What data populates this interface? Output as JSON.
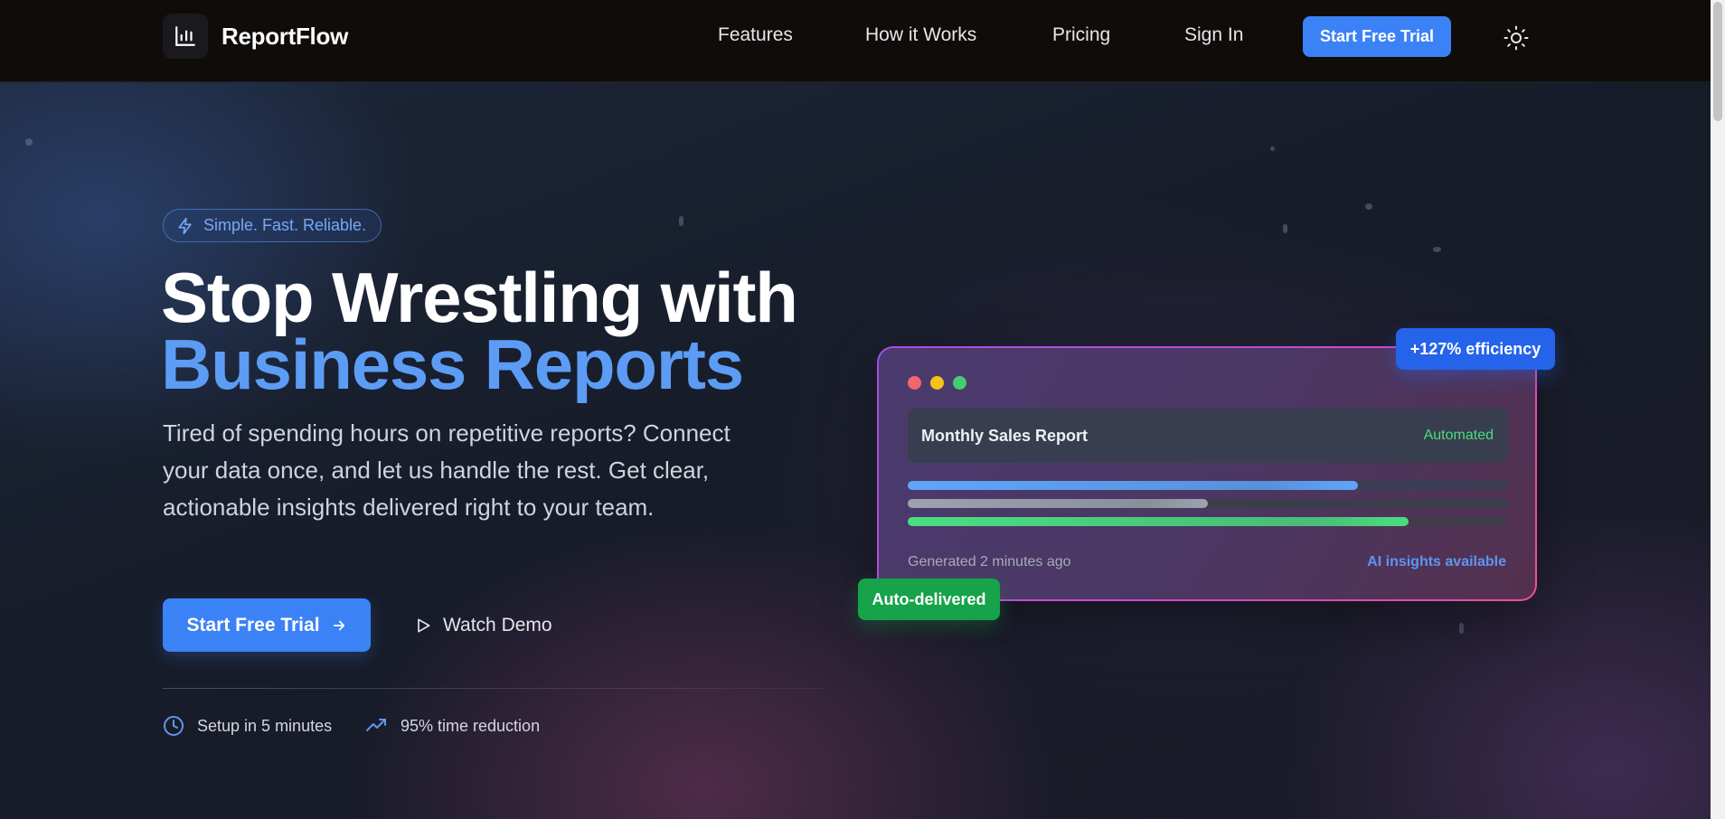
{
  "nav": {
    "brand": "ReportFlow",
    "links": [
      "Features",
      "How it Works",
      "Pricing",
      "Sign In"
    ],
    "cta_label": "Start Free Trial",
    "logo_icon": "bar-chart-icon",
    "theme_icon": "sun-icon"
  },
  "hero": {
    "badge_label": "Simple. Fast. Reliable.",
    "badge_icon": "lightning-icon",
    "headline_line1": "Stop Wrestling with",
    "headline_line2": "Business Reports",
    "subtitle": "Tired of spending hours on repetitive reports? Connect your data once, and let us handle the rest. Get clear, actionable insights delivered right to your team.",
    "primary_cta": "Start Free Trial",
    "secondary_cta": "Watch Demo",
    "stats": [
      {
        "icon": "clock-icon",
        "label": "Setup in 5 minutes"
      },
      {
        "icon": "trending-up-icon",
        "label": "95% time reduction"
      }
    ]
  },
  "preview_card": {
    "report_title": "Monthly Sales Report",
    "report_status": "Automated",
    "bars": [
      {
        "fill_fraction": 0.75,
        "color": "#60a5fa"
      },
      {
        "fill_fraction": 0.5,
        "color": "#9ca3af"
      },
      {
        "fill_fraction": 0.835,
        "color": "#4ade80"
      }
    ],
    "generated_text": "Generated 2 minutes ago",
    "ai_text": "AI insights available",
    "efficiency_badge": "+127% efficiency",
    "delivery_badge": "Auto-delivered"
  },
  "colors": {
    "accent": "#3b82f6",
    "headline_accent": "#5c9cf5",
    "success": "#16a34a",
    "nav_bg": "#0f0c0a"
  }
}
